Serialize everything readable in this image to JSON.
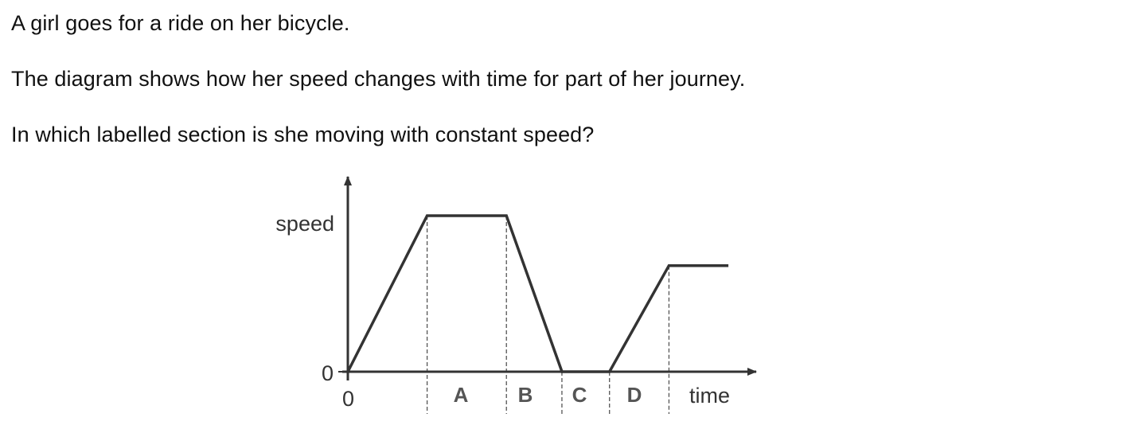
{
  "question": {
    "line1": "A girl goes for a ride on her bicycle.",
    "line2": "The diagram shows how her speed changes with time for part of her journey.",
    "line3": "In which labelled section is she moving with constant speed?"
  },
  "diagram": {
    "y_axis_label": "speed",
    "x_axis_label": "time",
    "y_origin_label": "0",
    "x_origin_label": "0",
    "sections": [
      "A",
      "B",
      "C",
      "D"
    ]
  },
  "chart_data": {
    "type": "line",
    "title": "",
    "xlabel": "time",
    "ylabel": "speed",
    "tick_labels": {
      "x": [
        "0"
      ],
      "y": [
        "0"
      ]
    },
    "series": [
      {
        "x": [
          0,
          1,
          2,
          2.7,
          3.3,
          4.05,
          4.8
        ],
        "y": [
          0,
          1,
          1,
          0,
          0,
          0.68,
          0.68
        ]
      }
    ],
    "sections": [
      {
        "label": "A",
        "x_start": 1,
        "x_end": 2
      },
      {
        "label": "B",
        "x_start": 2,
        "x_end": 2.7
      },
      {
        "label": "C",
        "x_start": 2.7,
        "x_end": 3.3
      },
      {
        "label": "D",
        "x_start": 3.3,
        "x_end": 4.05
      }
    ],
    "xlim": [
      0,
      5.15
    ],
    "ylim": [
      0,
      1.25
    ],
    "grid": false,
    "legend": "none"
  }
}
